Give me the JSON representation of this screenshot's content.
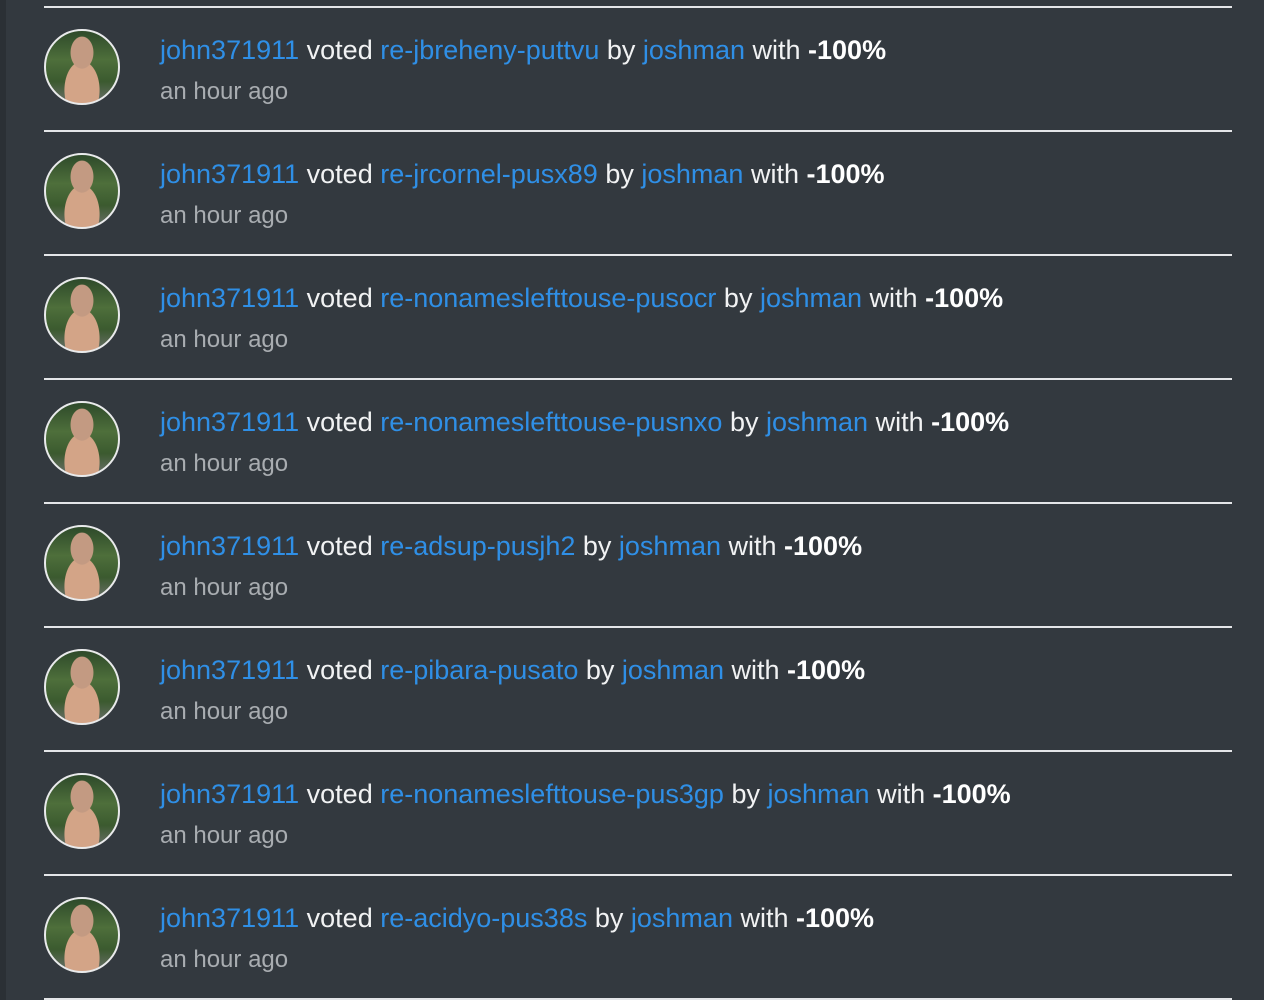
{
  "feed": {
    "items": [
      {
        "voter": "john371911",
        "verb": "voted",
        "post": "re-jbreheny-puttvu",
        "by": "by",
        "author": "joshman",
        "with": "with",
        "weight": "-100%",
        "time": "an hour ago"
      },
      {
        "voter": "john371911",
        "verb": "voted",
        "post": "re-jrcornel-pusx89",
        "by": "by",
        "author": "joshman",
        "with": "with",
        "weight": "-100%",
        "time": "an hour ago"
      },
      {
        "voter": "john371911",
        "verb": "voted",
        "post": "re-nonameslefttouse-pusocr",
        "by": "by",
        "author": "joshman",
        "with": "with",
        "weight": "-100%",
        "time": "an hour ago"
      },
      {
        "voter": "john371911",
        "verb": "voted",
        "post": "re-nonameslefttouse-pusnxo",
        "by": "by",
        "author": "joshman",
        "with": "with",
        "weight": "-100%",
        "time": "an hour ago"
      },
      {
        "voter": "john371911",
        "verb": "voted",
        "post": "re-adsup-pusjh2",
        "by": "by",
        "author": "joshman",
        "with": "with",
        "weight": "-100%",
        "time": "an hour ago"
      },
      {
        "voter": "john371911",
        "verb": "voted",
        "post": "re-pibara-pusato",
        "by": "by",
        "author": "joshman",
        "with": "with",
        "weight": "-100%",
        "time": "an hour ago"
      },
      {
        "voter": "john371911",
        "verb": "voted",
        "post": "re-nonameslefttouse-pus3gp",
        "by": "by",
        "author": "joshman",
        "with": "with",
        "weight": "-100%",
        "time": "an hour ago"
      },
      {
        "voter": "john371911",
        "verb": "voted",
        "post": "re-acidyo-pus38s",
        "by": "by",
        "author": "joshman",
        "with": "with",
        "weight": "-100%",
        "time": "an hour ago"
      }
    ]
  },
  "colors": {
    "background": "#33393f",
    "link": "#2f8fe6",
    "text": "#f1f2f3",
    "muted": "#a9adb1",
    "divider": "#e4e6e8"
  },
  "icons": {
    "avatar": "user-avatar-photo"
  }
}
